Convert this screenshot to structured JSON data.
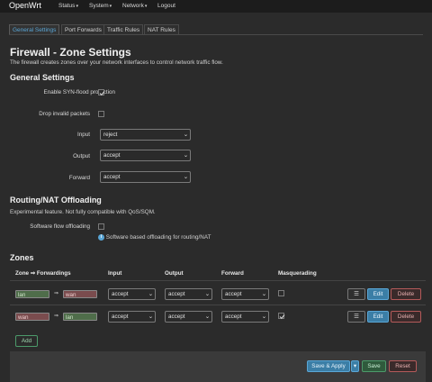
{
  "header": {
    "brand": "OpenWrt",
    "menu": [
      {
        "label": "Status",
        "caret": "▾"
      },
      {
        "label": "System",
        "caret": "▾"
      },
      {
        "label": "Network",
        "caret": "▾"
      },
      {
        "label": "Logout",
        "caret": ""
      }
    ]
  },
  "tabs": [
    "General Settings",
    "Port Forwards",
    "Traffic Rules",
    "NAT Rules"
  ],
  "page": {
    "title": "Firewall - Zone Settings",
    "description": "The firewall creates zones over your network interfaces to control network traffic flow."
  },
  "general": {
    "heading": "General Settings",
    "syn_flood_label": "Enable SYN-flood protection",
    "syn_flood_checked": true,
    "drop_invalid_label": "Drop invalid packets",
    "drop_invalid_checked": false,
    "input_label": "Input",
    "input_value": "reject",
    "output_label": "Output",
    "output_value": "accept",
    "forward_label": "Forward",
    "forward_value": "accept"
  },
  "offloading": {
    "heading": "Routing/NAT Offloading",
    "description": "Experimental feature. Not fully compatible with QoS/SQM.",
    "flow_label": "Software flow offloading",
    "flow_checked": false,
    "hint": "Software based offloading for routing/NAT",
    "hint_icon": "info-icon"
  },
  "zones": {
    "heading": "Zones",
    "columns": [
      "Zone ⇒ Forwardings",
      "Input",
      "Output",
      "Forward",
      "Masquerading"
    ],
    "rows": [
      {
        "zone": "lan",
        "forward_to": "wan",
        "arrow": "⇒",
        "input": "accept",
        "output": "accept",
        "forward": "accept",
        "masquerading": false
      },
      {
        "zone": "wan",
        "forward_to": "lan",
        "arrow": "⇒",
        "input": "accept",
        "output": "accept",
        "forward": "accept",
        "masquerading": true
      }
    ],
    "buttons": {
      "drag": "☰",
      "edit": "Edit",
      "delete": "Delete",
      "add": "Add"
    }
  },
  "footer": {
    "save_apply": "Save & Apply",
    "save_apply_caret": "▾",
    "save": "Save",
    "reset": "Reset"
  },
  "colors": {
    "accent": "#5aa6d6",
    "lan_zone": "#4f6d4a",
    "wan_zone": "#7a4c4e",
    "background": "#2b2b2b"
  }
}
